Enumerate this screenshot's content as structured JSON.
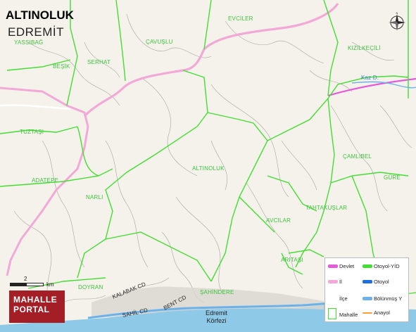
{
  "map": {
    "title": "ALTINOLUK",
    "subtitle": "EDREMİT",
    "colors": {
      "land": "#f4f2ea",
      "sea": "#8ec9e8",
      "neighbourhood_border": "#44dd33",
      "district_border": "#f2a9d8",
      "state_road": "#e35bd8",
      "coastal_road": "#6cb2ea",
      "river": "#6cb2ea"
    },
    "places": [
      "YASSIBAĞ",
      "EVCİLER",
      "ÇAVUŞLU",
      "KIZILKEÇİLİ",
      "BEŞİK",
      "SERHAT",
      "TUZTAŞI",
      "ÇAMLIBEL",
      "ALTINOLUK",
      "ADATEPE",
      "GÜRE",
      "NARLI",
      "TAHTAKUŞLAR",
      "AVCILAR",
      "ARITAŞI",
      "DOYRAN",
      "ŞAHİNDERE"
    ],
    "water_labels": [
      "Kaz D."
    ],
    "road_labels": [
      "KALABAK CD",
      "SAHİL CD",
      "BENT CD"
    ],
    "sea_label": [
      "Edremit",
      "Körfezi"
    ],
    "scale": {
      "value": "2",
      "unit": "km"
    },
    "logo_lines": [
      "MAHALLE",
      "PORTAL"
    ],
    "compass_icon": "compass-rose-icon",
    "legend": [
      {
        "label": "Devlet",
        "color": "#e35bd8"
      },
      {
        "label": "Otoyol-YİD",
        "color": "#44dd33"
      },
      {
        "label": "İl",
        "color": "#f2a9d8"
      },
      {
        "label": "Otoyol",
        "color": "#1f6fe0"
      },
      {
        "label": "İlçe",
        "color": "#cccccc"
      },
      {
        "label": "Bölünmüş Y",
        "color": "#6cb2ea"
      },
      {
        "label": "Mahalle",
        "color": "#44dd33"
      },
      {
        "label": "Anayol",
        "color": "#f2a33a"
      }
    ]
  }
}
